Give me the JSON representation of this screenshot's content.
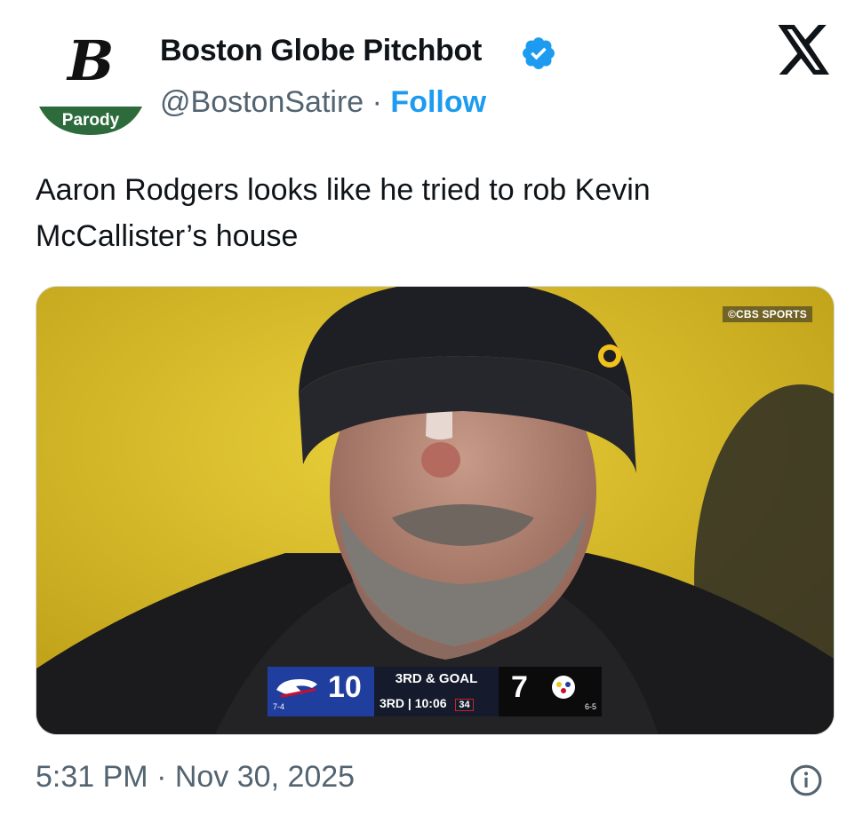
{
  "author": {
    "display_name": "Boston Globe Pitchbot",
    "handle": "@BostonSatire",
    "separator": "·",
    "follow_label": "Follow",
    "avatar_letter": "B",
    "parody_label": "Parody",
    "verified": true
  },
  "tweet": {
    "text": "Aaron Rodgers looks like he tried to rob Kevin McCallister’s house"
  },
  "media": {
    "watermark": "©CBS SPORTS",
    "scorebug": {
      "home_score": "10",
      "home_record": "7-4",
      "down_distance": "3RD & GOAL",
      "quarter": "3RD",
      "clock": "10:06",
      "play_clock": "34",
      "away_score": "7",
      "away_record": "6-5"
    }
  },
  "footer": {
    "timestamp": "5:31 PM · Nov 30, 2025"
  },
  "colors": {
    "accent": "#1d9bf0",
    "parody_badge": "#2e6b3c",
    "muted_text": "#536471"
  },
  "icons": {
    "verified": "verified-badge-icon",
    "x_logo": "x-logo-icon",
    "info": "info-icon"
  }
}
